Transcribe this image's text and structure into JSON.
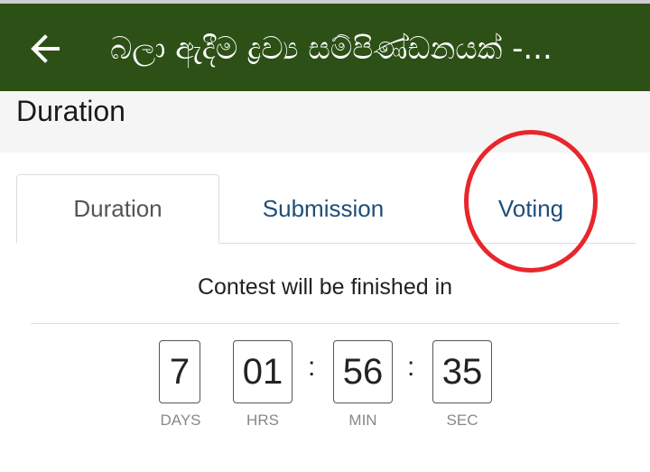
{
  "appbar": {
    "title": "බලා ඇදීම ද්‍රව්‍ය සම්පිණ්ඩනයක් -...",
    "back_icon": "arrow-left-icon",
    "background": "#2d5016"
  },
  "section": {
    "title": "Duration"
  },
  "tabs": [
    {
      "label": "Duration",
      "active": true
    },
    {
      "label": "Submission",
      "active": false
    },
    {
      "label": "Voting",
      "active": false
    }
  ],
  "countdown": {
    "message": "Contest will be finished in",
    "days": "7",
    "hours": "01",
    "minutes": "56",
    "seconds": "35",
    "separator": ":",
    "labels": {
      "days": "DAYS",
      "hours": "HRS",
      "minutes": "MIN",
      "seconds": "SEC"
    }
  },
  "annotation": {
    "color": "#e8262b"
  }
}
